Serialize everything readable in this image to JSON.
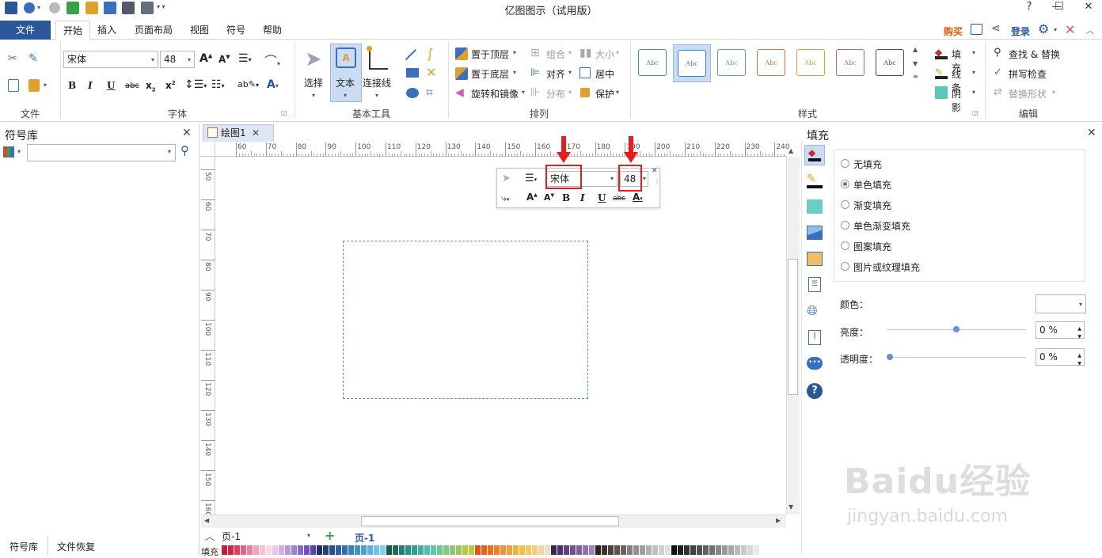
{
  "app": {
    "title": "亿图图示（试用版）"
  },
  "menu": {
    "file": "文件",
    "tabs": [
      "开始",
      "插入",
      "页面布局",
      "视图",
      "符号",
      "帮助"
    ],
    "buy": "购买",
    "login": "登录"
  },
  "ribbon": {
    "groups": {
      "file": "文件",
      "font": "字体",
      "basic_tools": "基本工具",
      "arrange": "排列",
      "style": "样式",
      "edit": "编辑"
    },
    "font_name": "宋体",
    "font_size": "48",
    "tools": {
      "select": "选择",
      "text": "文本",
      "connector": "连接线"
    },
    "arrange": {
      "bring_front": "置于顶层",
      "send_back": "置于底层",
      "rotate_mirror": "旋转和镜像",
      "group": "组合",
      "align": "对齐",
      "distribute": "分布",
      "size": "大小",
      "center": "居中",
      "protect": "保护"
    },
    "style_sample": "Abc",
    "style_colors": [
      "#3a9a8a",
      "#3a7bd5",
      "#5aa0b0",
      "#e07040",
      "#e09a30",
      "#c060a0",
      "#404a8a"
    ],
    "fill": "填充",
    "line": "线条",
    "shadow": "阴影",
    "edit": {
      "find_replace": "查找 & 替换",
      "spell_check": "拼写检查",
      "replace_shape": "替换形状"
    }
  },
  "symbol_library": {
    "title": "符号库",
    "search_placeholder": ""
  },
  "document_tab": {
    "label": "绘图1"
  },
  "ruler": {
    "h_ticks": [
      "60",
      "70",
      "80",
      "90",
      "100",
      "110",
      "120",
      "130",
      "140",
      "150",
      "160",
      "170",
      "180",
      "190",
      "200",
      "210",
      "220",
      "230",
      "240"
    ],
    "v_ticks": [
      "50",
      "60",
      "70",
      "80",
      "90",
      "100",
      "110",
      "120",
      "130",
      "140",
      "150",
      "160"
    ]
  },
  "floating_toolbar": {
    "font_name": "宋体",
    "font_size": "48"
  },
  "fill_panel": {
    "title": "填充",
    "options": [
      "无填充",
      "单色填充",
      "渐变填充",
      "单色渐变填充",
      "图案填充",
      "图片或纹理填充"
    ],
    "selected_index": 1,
    "color_label": "颜色：",
    "brightness_label": "亮度：",
    "brightness_value": "0 %",
    "brightness_fraction": 0.5,
    "transparency_label": "透明度：",
    "transparency_value": "0 %",
    "transparency_fraction": 0.0
  },
  "pages": {
    "selector": "页-1",
    "current": "页-1"
  },
  "bottom_tabs": {
    "symbol_library": "符号库",
    "file_recovery": "文件恢复",
    "fill_label": "填充"
  },
  "watermark": {
    "logo": "Baidu经验",
    "url": "jingyan.baidu.com"
  },
  "palette": [
    "#c0203a",
    "#d02840",
    "#e04060",
    "#e86080",
    "#f080a0",
    "#f4a0b8",
    "#f8c0d0",
    "#fcd8e4",
    "#e8c8e8",
    "#d0b0e0",
    "#b898d8",
    "#a080d0",
    "#8868c8",
    "#7050c0",
    "#5840b8",
    "#1f2f6a",
    "#24407f",
    "#285090",
    "#2c60a0",
    "#3070b0",
    "#3880c0",
    "#4090d0",
    "#50a0d8",
    "#60b0e0",
    "#70c0e8",
    "#80d0f0",
    "#1a5a4a",
    "#1f6a55",
    "#24806a",
    "#2a9080",
    "#30a090",
    "#40b0a0",
    "#50c0a8",
    "#60c8a0",
    "#70c890",
    "#80c880",
    "#90c870",
    "#a0c860",
    "#b0c850",
    "#c0c840",
    "#e05020",
    "#e86020",
    "#f07020",
    "#f08030",
    "#f09040",
    "#f0a040",
    "#f0b040",
    "#f0c040",
    "#f0c860",
    "#f0d080",
    "#f0d8a0",
    "#f0e0c0",
    "#402060",
    "#503070",
    "#604080",
    "#705090",
    "#8060a0",
    "#9070b0",
    "#a080c0",
    "#302020",
    "#403030",
    "#504040",
    "#605050",
    "#706060",
    "#808080",
    "#909090",
    "#a0a0a0",
    "#b0b0b0",
    "#c0c0c0",
    "#d0d0d0",
    "#e0e0e0",
    "#101010",
    "#202020",
    "#303030",
    "#404040",
    "#505050",
    "#606060",
    "#707070",
    "#888888",
    "#989898",
    "#a8a8a8",
    "#b8b8b8",
    "#c8c8c8",
    "#d8d8d8",
    "#e8e8e8"
  ]
}
